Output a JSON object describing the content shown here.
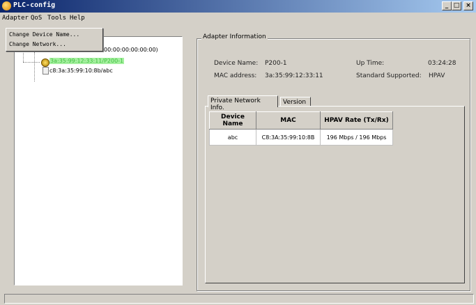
{
  "window": {
    "title": "PLC-config",
    "minimize": "_",
    "maximize": "□",
    "close": "×"
  },
  "menubar": {
    "items": [
      "Adapter",
      "QoS",
      "Tools",
      "Help"
    ]
  },
  "adapter_menu": {
    "items": [
      "Change Device Name...",
      "Change Network..."
    ]
  },
  "tree": {
    "root_label": "00:00:00:00:00:00)",
    "selected_label": "3a:35:99:12:33:11/P200-1",
    "child_label": "c8:3a:35:99:10:8b/abc"
  },
  "adapter_info": {
    "group_title": "Adapter Information",
    "device_name_label": "Device Name:",
    "device_name_value": "P200-1",
    "mac_label": "MAC address:",
    "mac_value": "3a:35:99:12:33:11",
    "uptime_label": "Up Time:",
    "uptime_value": "03:24:28",
    "standard_label": "Standard Supported:",
    "standard_value": "HPAV"
  },
  "tabs": [
    "Private Network Info.",
    "Version"
  ],
  "network_table": {
    "headers": [
      "Device Name",
      "MAC",
      "HPAV Rate (Tx/Rx)"
    ],
    "rows": [
      [
        "abc",
        "C8:3A:35:99:10:8B",
        "196 Mbps / 196 Mbps"
      ]
    ]
  }
}
